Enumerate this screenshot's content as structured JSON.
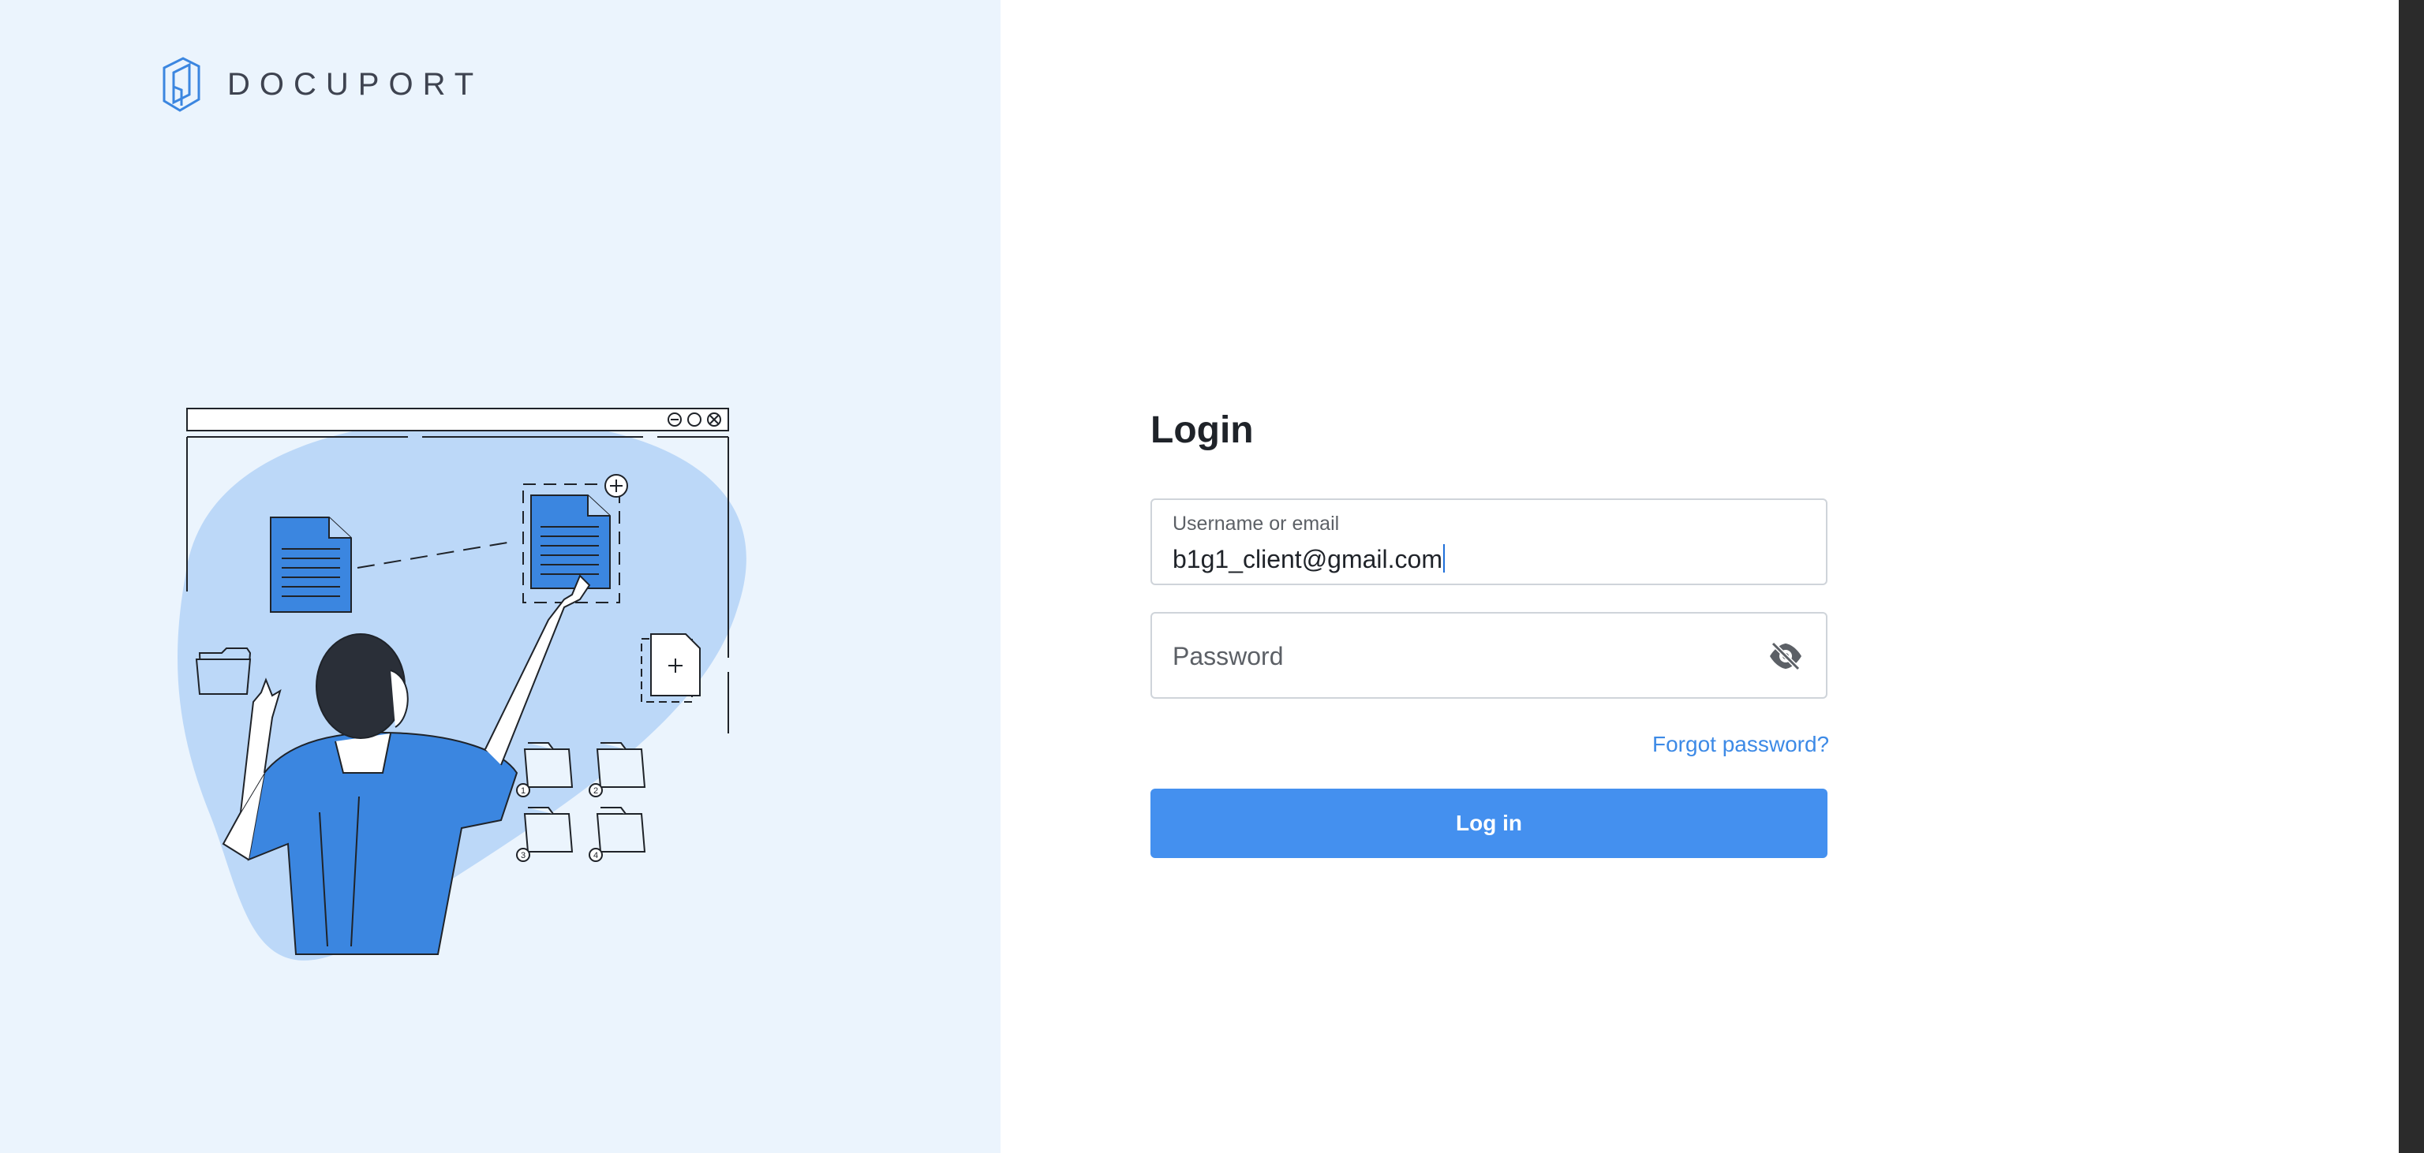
{
  "brand": {
    "name": "DOCUPORT",
    "accent": "#4490ef",
    "panel_bg": "#ebf4fd"
  },
  "login": {
    "title": "Login",
    "username": {
      "label": "Username or email",
      "value": "b1g1_client@gmail.com"
    },
    "password": {
      "placeholder": "Password",
      "toggle_icon": "eye-off-icon"
    },
    "forgot_link": "Forgot password?",
    "submit_label": "Log in"
  },
  "illustration": {
    "folder_badges": [
      "1",
      "2",
      "3",
      "4"
    ],
    "icons": [
      "minimize-icon",
      "maximize-icon",
      "close-icon",
      "add-icon",
      "document-icon",
      "folder-icon"
    ]
  }
}
